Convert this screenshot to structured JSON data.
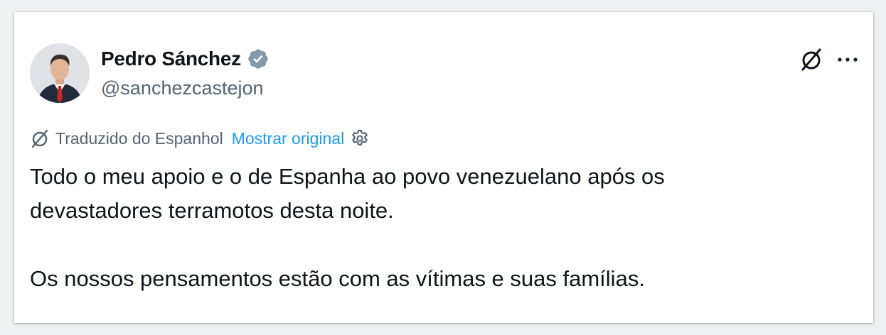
{
  "author": {
    "name": "Pedro Sánchez",
    "handle": "@sanchezcastejon",
    "verified_color": "#829aab"
  },
  "translation": {
    "label": "Traduzido do Espanhol",
    "show_original": "Mostrar original",
    "link_color": "#1d9bf0"
  },
  "tweet": {
    "line1": "Todo o meu apoio e o de Espanha ao povo venezuelano após os",
    "line2": "devastadores terramotos desta noite.",
    "line3": "Os nossos pensamentos estão com as vítimas e suas famílias."
  },
  "icons": {
    "verified": "verified-badge-icon",
    "grok": "grok-icon",
    "more": "more-options-icon",
    "gear": "gear-icon"
  }
}
